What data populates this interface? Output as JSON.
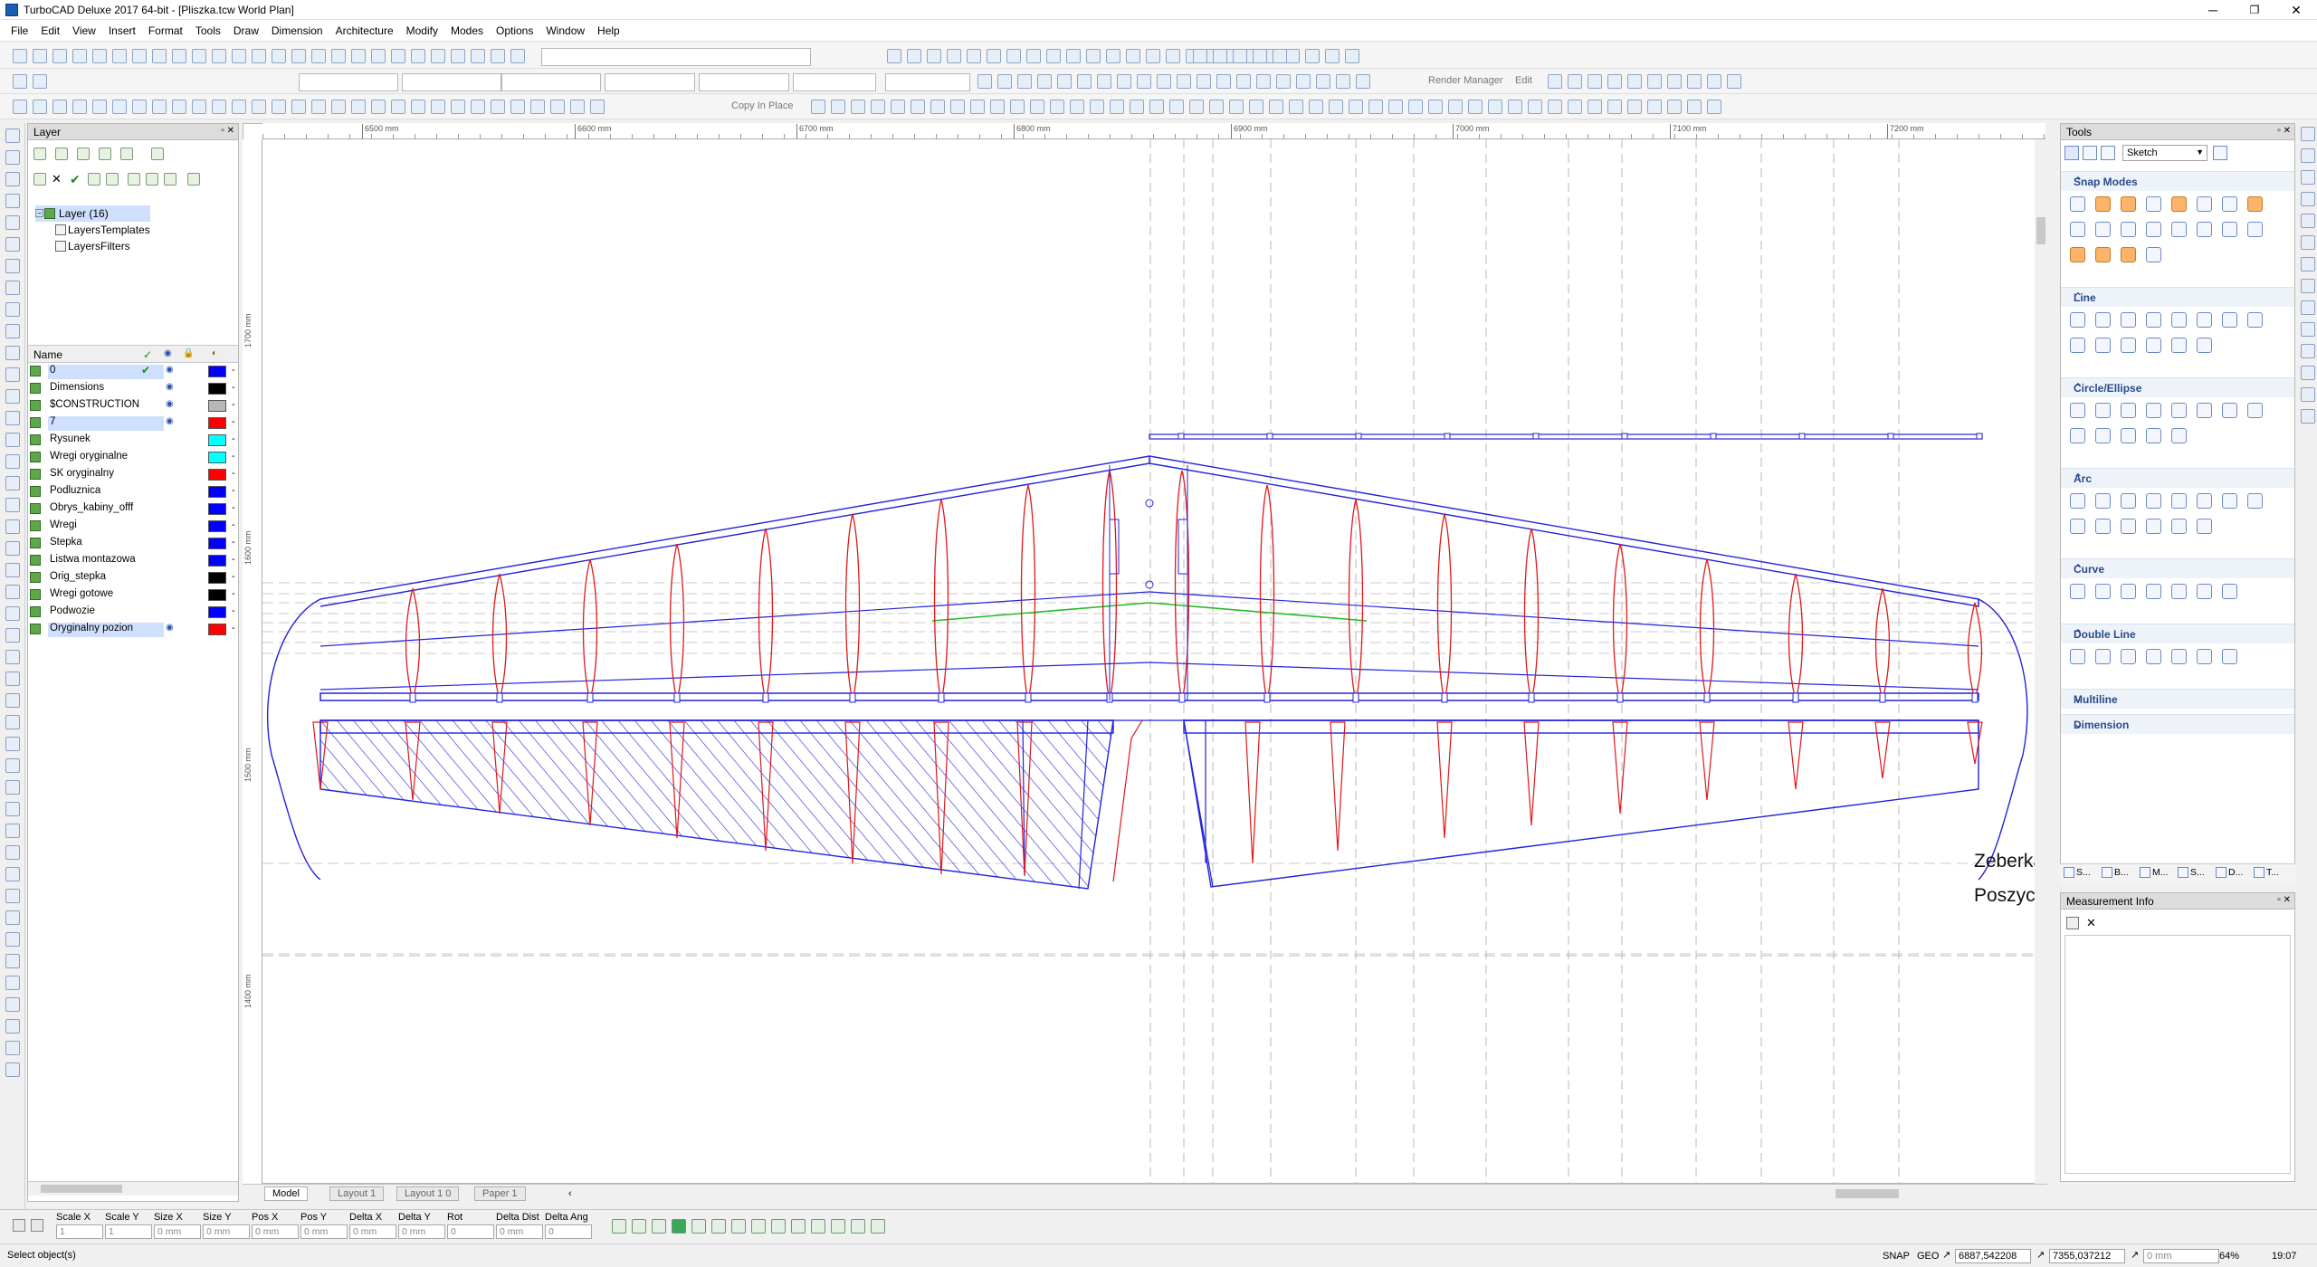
{
  "window": {
    "title": "TurboCAD Deluxe 2017 64-bit - [Pliszka.tcw World Plan]",
    "minimize": "─",
    "restore": "❐",
    "close": "✕"
  },
  "menu": [
    "File",
    "Edit",
    "View",
    "Insert",
    "Format",
    "Tools",
    "Draw",
    "Dimension",
    "Architecture",
    "Modify",
    "Modes",
    "Options",
    "Window",
    "Help"
  ],
  "toolbar": {
    "copy_in_place": "Copy In Place",
    "render_manager": "Render Manager",
    "edit": "Edit"
  },
  "layer_panel": {
    "title": "Layer",
    "tree": [
      {
        "label": "Layer (16)",
        "selected": true
      },
      {
        "label": "LayersTemplates",
        "selected": false
      },
      {
        "label": "LayersFilters",
        "selected": false
      }
    ],
    "columns": {
      "name": "Name",
      "visible_check": "✓",
      "eye": "◉",
      "lock": "🔒",
      "color": "◐"
    },
    "rows": [
      {
        "name": "0",
        "check": true,
        "eye": true,
        "color": "#0000ff",
        "highlight": true
      },
      {
        "name": "Dimensions",
        "check": false,
        "eye": true,
        "color": "#000000",
        "highlight": false
      },
      {
        "name": "$CONSTRUCTION",
        "check": false,
        "eye": true,
        "color": "#b8b8b8",
        "highlight": false
      },
      {
        "name": "7",
        "check": false,
        "eye": true,
        "color": "#ff0000",
        "highlight": true
      },
      {
        "name": "Rysunek",
        "check": false,
        "eye": false,
        "color": "#00ffff",
        "highlight": false
      },
      {
        "name": "Wregi oryginalne",
        "check": false,
        "eye": false,
        "color": "#00ffff",
        "highlight": false
      },
      {
        "name": "SK oryginalny",
        "check": false,
        "eye": false,
        "color": "#ff0000",
        "highlight": false
      },
      {
        "name": "Podluznica",
        "check": false,
        "eye": false,
        "color": "#0000ff",
        "highlight": false
      },
      {
        "name": "Obrys_kabiny_offf",
        "check": false,
        "eye": false,
        "color": "#0000ff",
        "highlight": false
      },
      {
        "name": "Wregi",
        "check": false,
        "eye": false,
        "color": "#0000ff",
        "highlight": false
      },
      {
        "name": "Stepka",
        "check": false,
        "eye": false,
        "color": "#0000ff",
        "highlight": false
      },
      {
        "name": "Listwa montazowa",
        "check": false,
        "eye": false,
        "color": "#0000ff",
        "highlight": false
      },
      {
        "name": "Orig_stepka",
        "check": false,
        "eye": false,
        "color": "#000000",
        "highlight": false
      },
      {
        "name": "Wregi gotowe",
        "check": false,
        "eye": false,
        "color": "#000000",
        "highlight": false
      },
      {
        "name": "Podwozie",
        "check": false,
        "eye": false,
        "color": "#0000ff",
        "highlight": false
      },
      {
        "name": "Oryginalny pozion",
        "check": false,
        "eye": true,
        "color": "#ff0000",
        "highlight": true
      }
    ]
  },
  "ruler": {
    "labels": [
      "6500 mm",
      "6600 mm",
      "6700 mm",
      "6800 mm",
      "6900 mm",
      "7000 mm",
      "7100 mm",
      "7200 mm"
    ],
    "vlabels": [
      "1700 mm",
      "1600 mm",
      "1500 mm",
      "1400 mm"
    ]
  },
  "drawing_text": {
    "label1": "Zeberka",
    "label2": "Poszyc"
  },
  "tabs": [
    "Model",
    "Layout 1",
    "Layout 1 0",
    "Paper 1"
  ],
  "tools_panel": {
    "title": "Tools",
    "mode": "Sketch",
    "sections": [
      "Snap Modes",
      "Line",
      "Circle/Ellipse",
      "Arc",
      "Curve",
      "Double Line",
      "Multiline",
      "Dimension"
    ],
    "bottom_tabs": [
      "S...",
      "B...",
      "M...",
      "S...",
      "D...",
      "T..."
    ]
  },
  "measurement_panel": {
    "title": "Measurement Info"
  },
  "inspector": {
    "fields": [
      {
        "label": "Scale X",
        "value": "1"
      },
      {
        "label": "Scale Y",
        "value": "1"
      },
      {
        "label": "Size X",
        "value": "0 mm"
      },
      {
        "label": "Size Y",
        "value": "0 mm"
      },
      {
        "label": "Pos X",
        "value": "0 mm"
      },
      {
        "label": "Pos Y",
        "value": "0 mm"
      },
      {
        "label": "Delta X",
        "value": "0 mm"
      },
      {
        "label": "Delta Y",
        "value": "0 mm"
      },
      {
        "label": "Rot",
        "value": "0"
      },
      {
        "label": "Delta Dist",
        "value": "0 mm"
      },
      {
        "label": "Delta Ang",
        "value": "0"
      }
    ]
  },
  "status": {
    "message": "Select object(s)",
    "snap": "SNAP",
    "geo": "GEO",
    "coord_x": "6887,542208",
    "coord_y": "7355,037212",
    "coord_z": "0 mm",
    "zoom": "64%",
    "time": "19:07"
  }
}
